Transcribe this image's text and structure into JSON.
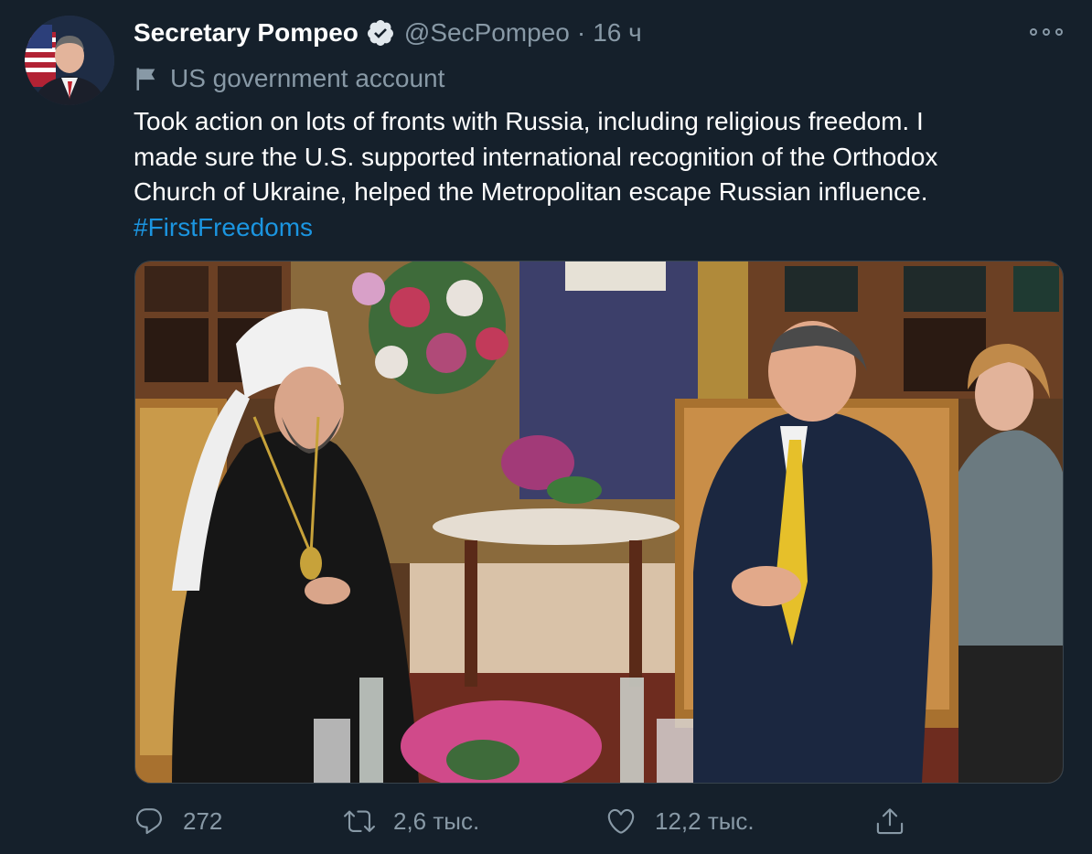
{
  "tweet": {
    "author": {
      "display_name": "Secretary Pompeo",
      "handle": "@SecPompeo",
      "separator": "·",
      "time": "16 ч"
    },
    "account_label": "US government account",
    "text_lines": [
      "Took action on lots of fronts with Russia, including religious freedom. I",
      "made sure the U.S. supported international recognition of the Orthodox",
      "Church of Ukraine, helped the Metropolitan escape Russian influence."
    ],
    "hashtag": "#FirstFreedoms",
    "actions": {
      "reply_count": "272",
      "retweet_count": "2,6 тыс.",
      "like_count": "12,2 тыс."
    },
    "icons": [
      "avatar",
      "verified-badge-icon",
      "more-icon",
      "government-flag-icon",
      "reply-icon",
      "retweet-icon",
      "like-icon",
      "share-icon"
    ]
  },
  "colors": {
    "background": "#15202b",
    "text_primary": "#ffffff",
    "text_secondary": "#8899a6",
    "link": "#1b95e0",
    "border": "#38444d"
  }
}
